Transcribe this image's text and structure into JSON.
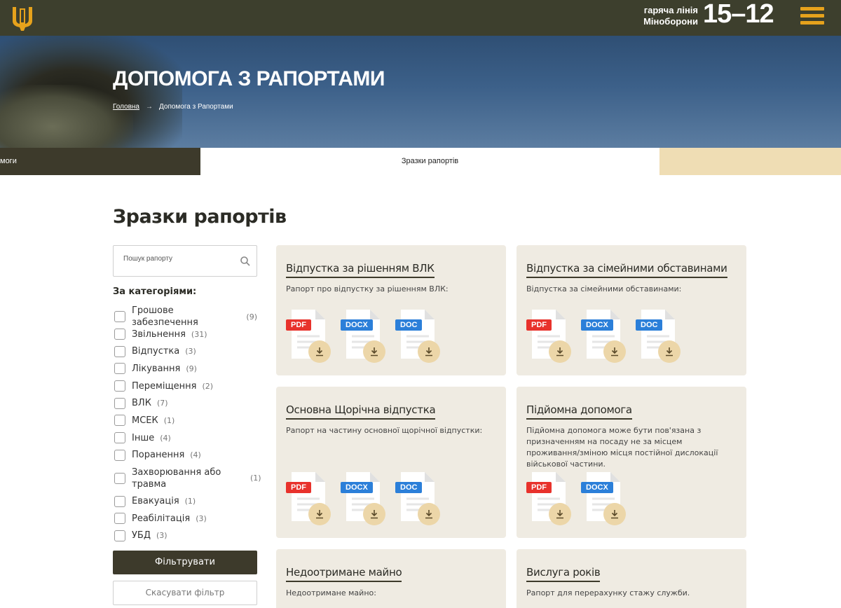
{
  "header": {
    "hotline_line1": "гаряча лінія",
    "hotline_line2": "Міноборони",
    "hotline_number": "15–12",
    "accent_color": "#e6a21c",
    "bar_color": "#3d3f2d",
    "menu_icon": "hamburger-icon",
    "logo_icon": "trident-icon"
  },
  "hero": {
    "title": "ДОПОМОГА З РАПОРТАМИ",
    "breadcrumb": {
      "home": "Головна",
      "current": "Допомога з Рапортами"
    }
  },
  "tabs": {
    "left": "моги",
    "active": "Зразки рапортів"
  },
  "main": {
    "title": "Зразки рапортів",
    "search_placeholder": "Пошук рапорту",
    "categories_heading": "За категоріями:",
    "categories": [
      {
        "label": "Грошове забезпечення",
        "count": "(9)"
      },
      {
        "label": "Звільнення",
        "count": "(31)"
      },
      {
        "label": "Відпустка",
        "count": "(3)"
      },
      {
        "label": "Лікування",
        "count": "(9)"
      },
      {
        "label": "Переміщення",
        "count": "(2)"
      },
      {
        "label": "ВЛК",
        "count": "(7)"
      },
      {
        "label": "МСЕК",
        "count": "(1)"
      },
      {
        "label": "Інше",
        "count": "(4)"
      },
      {
        "label": "Поранення",
        "count": "(4)"
      },
      {
        "label": "Захворювання або травма",
        "count": "(1)"
      },
      {
        "label": "Евакуація",
        "count": "(1)"
      },
      {
        "label": "Реабілітація",
        "count": "(3)"
      },
      {
        "label": "УБД",
        "count": "(3)"
      }
    ],
    "filter_button": "Фільтрувати",
    "reset_button": "Скасувати фільтр"
  },
  "cards": [
    {
      "title": "Відпустка за рішенням ВЛК",
      "desc": "Рапорт про відпустку за рішенням ВЛК:",
      "files": [
        "PDF",
        "DOCX",
        "DOC"
      ]
    },
    {
      "title": "Відпустка за сімейними обставинами",
      "desc": "Відпустка за сімейними обставинами:",
      "files": [
        "PDF",
        "DOCX",
        "DOC"
      ]
    },
    {
      "title": "Основна Щорічна відпустка",
      "desc": "Рапорт на частину основної щорічної відпустки:",
      "files": [
        "PDF",
        "DOCX",
        "DOC"
      ]
    },
    {
      "title": "Підйомна допомога",
      "desc": "Підйомна допомога може бути пов'язана з призначенням на посаду не за місцем проживання/зміною місця постійної дислокації військової частини.",
      "files": [
        "PDF",
        "DOCX"
      ]
    },
    {
      "title": "Недоотримане майно",
      "desc": "Недоотримане майно:",
      "files": []
    },
    {
      "title": "Вислуга років",
      "desc": "Рапорт для перерахунку стажу служби.",
      "files": []
    }
  ]
}
